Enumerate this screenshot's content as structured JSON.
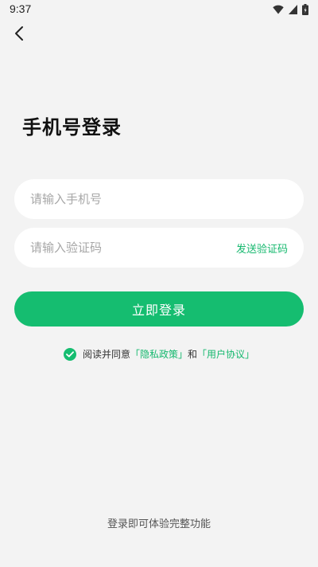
{
  "status_bar": {
    "time": "9:37"
  },
  "page": {
    "title": "手机号登录"
  },
  "phone_field": {
    "placeholder": "请输入手机号",
    "value": ""
  },
  "code_field": {
    "placeholder": "请输入验证码",
    "value": "",
    "send_code_label": "发送验证码"
  },
  "login_button": {
    "label": "立即登录"
  },
  "agreement": {
    "checked": true,
    "prefix": "阅读并同意",
    "privacy_link": "「隐私政策」",
    "conjunction": "和",
    "terms_link": "「用户协议」"
  },
  "footer": {
    "hint": "登录即可体验完整功能"
  },
  "colors": {
    "accent": "#15bd70",
    "background": "#f3f3f3"
  }
}
